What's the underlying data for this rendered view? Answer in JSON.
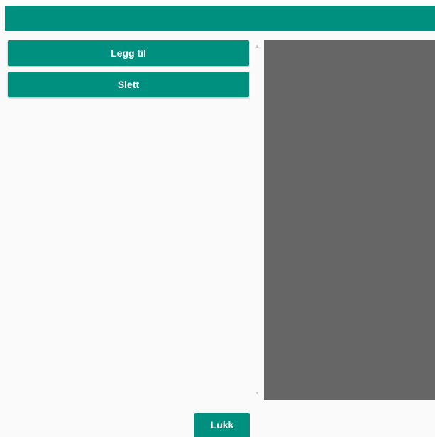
{
  "toolbar": {
    "add_label": "Legg til",
    "delete_label": "Slett"
  },
  "footer": {
    "close_label": "Lukk"
  },
  "colors": {
    "accent": "#009080",
    "panel": "#666666",
    "background": "#fafafa"
  },
  "icons": {
    "scroll_up": "scroll-up-arrow-icon",
    "scroll_down": "scroll-down-arrow-icon"
  }
}
